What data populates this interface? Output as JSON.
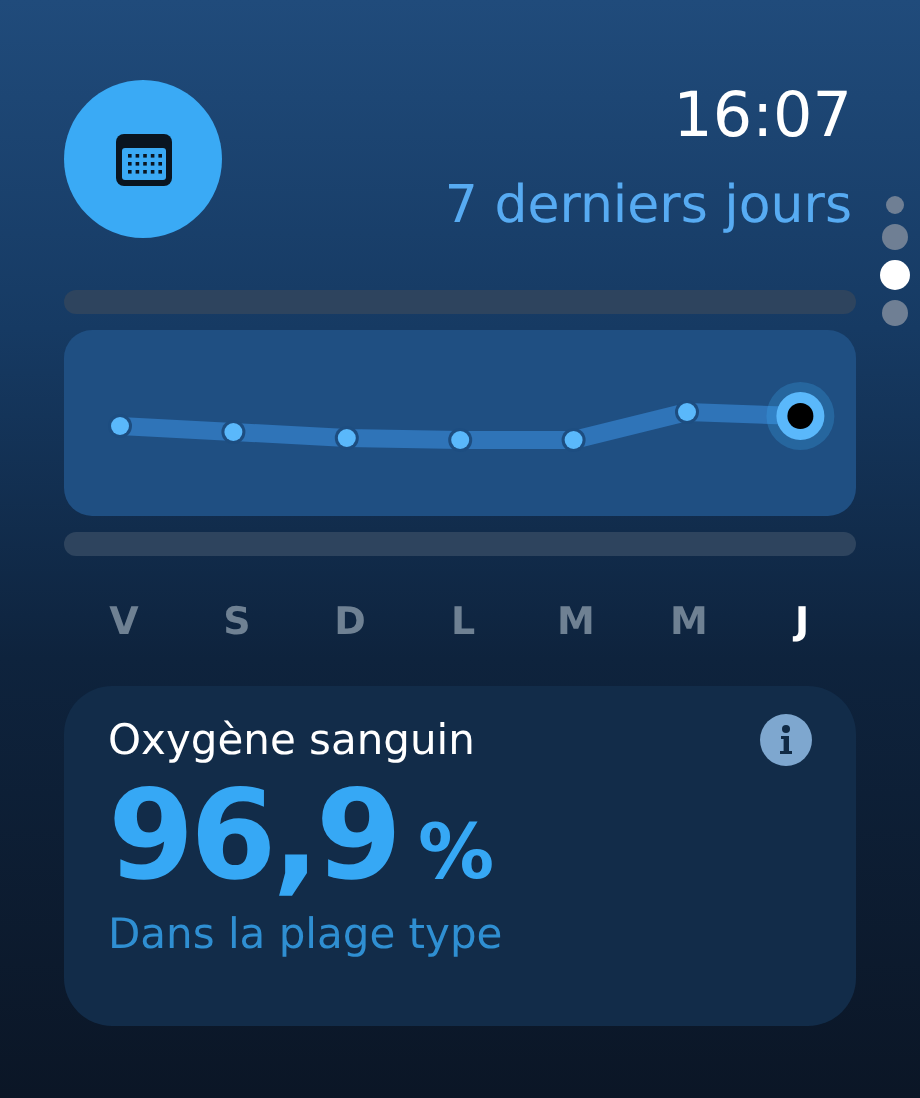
{
  "time": "16:07",
  "period": "7 derniers jours",
  "page_dots": [
    {
      "selected": false
    },
    {
      "selected": false
    },
    {
      "selected": true
    },
    {
      "selected": false
    }
  ],
  "days": [
    {
      "label": "V",
      "selected": false
    },
    {
      "label": "S",
      "selected": false
    },
    {
      "label": "D",
      "selected": false
    },
    {
      "label": "L",
      "selected": false
    },
    {
      "label": "M",
      "selected": false
    },
    {
      "label": "M",
      "selected": false
    },
    {
      "label": "J",
      "selected": true
    }
  ],
  "card": {
    "title": "Oxygène sanguin",
    "value": "96,9",
    "unit": "%",
    "note": "Dans la plage type"
  }
}
